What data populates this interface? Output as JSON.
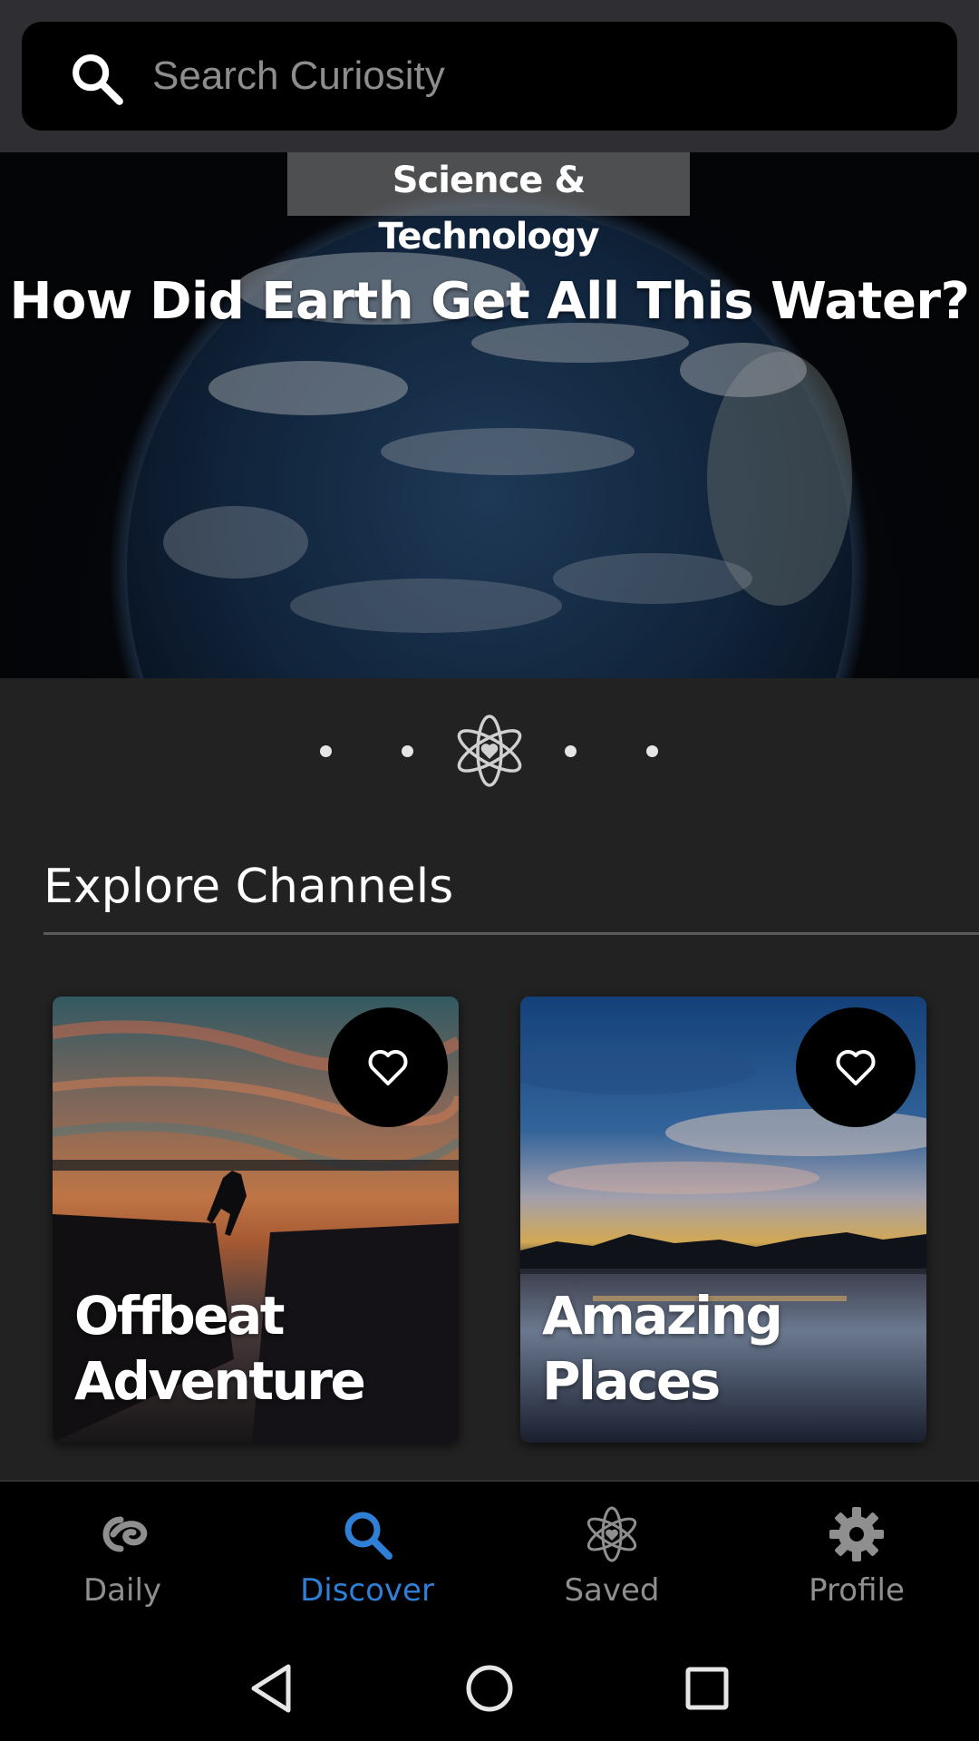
{
  "search": {
    "placeholder": "Search Curiosity",
    "icon": "search-icon"
  },
  "hero": {
    "category": "Science & Technology",
    "title": "How Did Earth Get All This Water?",
    "pager": {
      "total_dots": 5,
      "active_index": 2,
      "active_icon": "atom-heart-icon"
    }
  },
  "explore": {
    "title": "Explore Channels",
    "channels": [
      {
        "label_line1": "Offbeat",
        "label_line2": "Adventure",
        "favorite_icon": "heart-outline-icon"
      },
      {
        "label_line1": "",
        "label_line2": "Amazing Places",
        "favorite_icon": "heart-outline-icon"
      }
    ]
  },
  "bottom_nav": {
    "items": [
      {
        "label": "Daily",
        "icon": "curiosity-logo-icon",
        "active": false
      },
      {
        "label": "Discover",
        "icon": "search-icon",
        "active": true
      },
      {
        "label": "Saved",
        "icon": "atom-heart-icon",
        "active": false
      },
      {
        "label": "Profile",
        "icon": "gear-icon",
        "active": false
      }
    ],
    "active_color": "#2f7fd6",
    "inactive_color": "#8f8f8f"
  },
  "system_nav": {
    "back": "back-icon",
    "home": "home-icon",
    "recents": "recents-icon"
  }
}
